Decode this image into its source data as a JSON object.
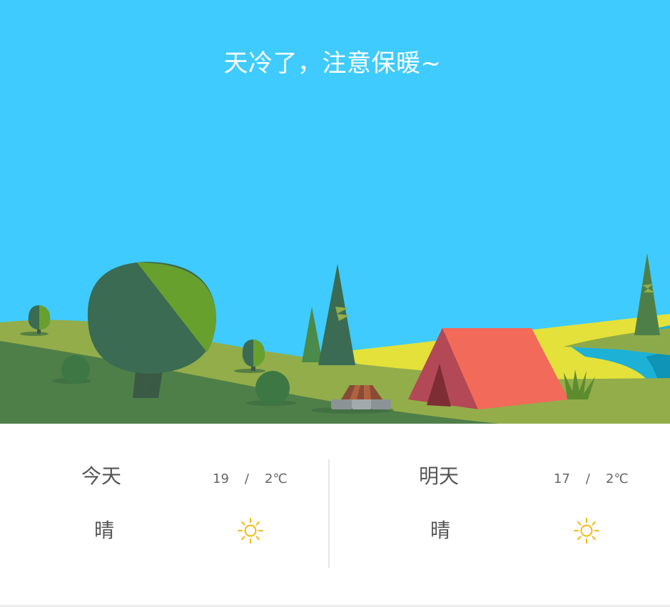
{
  "hero": {
    "title": "天冷了，注意保暖~"
  },
  "forecast": {
    "today": {
      "label": "今天",
      "high": "19",
      "separator": "/",
      "low": "2℃",
      "condition": "晴",
      "icon": "sun-icon"
    },
    "tomorrow": {
      "label": "明天",
      "high": "17",
      "separator": "/",
      "low": "2℃",
      "condition": "晴",
      "icon": "sun-icon"
    }
  },
  "colors": {
    "sky": "#3fcbfd",
    "hill_light": "#92ad4a",
    "hill_dark": "#4f7f49",
    "tree_dark": "#3b6b52",
    "tree_light": "#68a02e",
    "tent": "#f26a5a",
    "tent_side": "#b34856",
    "sun": "#f6b713",
    "text": "#555555"
  }
}
